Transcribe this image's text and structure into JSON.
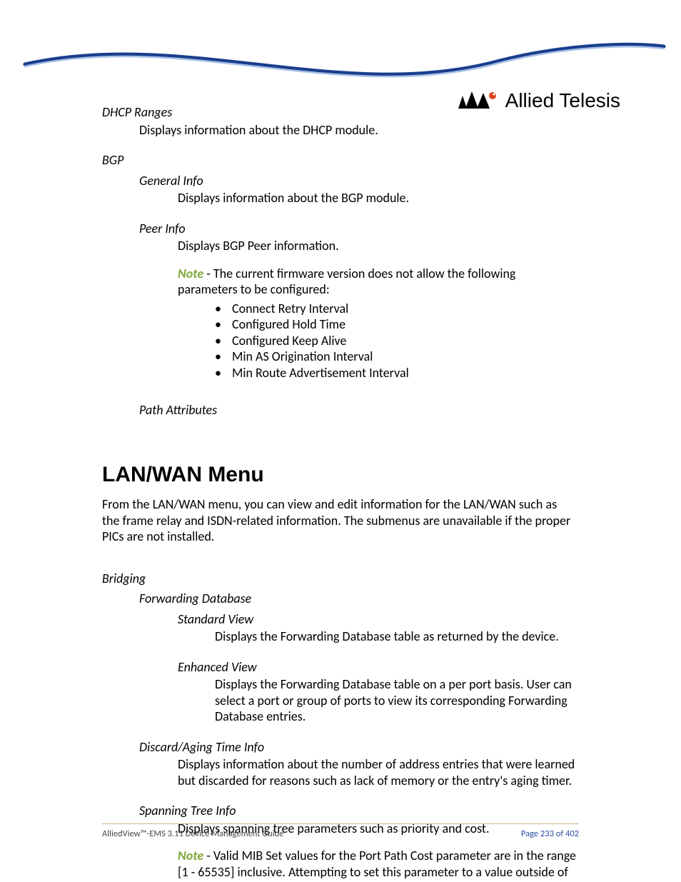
{
  "brand": "Allied Telesis",
  "sections": {
    "dhcp_ranges": {
      "term": "DHCP Ranges",
      "desc": "Displays information about the DHCP module."
    },
    "bgp": {
      "term": "BGP",
      "general": {
        "term": "General Info",
        "desc": "Displays information about the BGP module."
      },
      "peer": {
        "term": "Peer Info",
        "desc": "Displays BGP Peer information.",
        "note_label": "Note",
        "note_text": " - The current firmware version does not allow the following parameters to be configured:",
        "bullets": [
          "Connect Retry Interval",
          "Configured Hold Time",
          "Configured Keep Alive",
          "Min AS Origination Interval",
          "Min Route Advertisement Interval"
        ]
      },
      "path_attributes": {
        "term": "Path Attributes"
      }
    },
    "lanwan": {
      "heading": "LAN/WAN Menu",
      "intro": "From the LAN/WAN menu, you can view and edit information for the LAN/WAN such as the frame relay and ISDN-related information. The submenus are unavailable if the proper PICs are not installed.",
      "bridging": {
        "term": "Bridging",
        "fdb": {
          "term": "Forwarding Database",
          "standard": {
            "term": "Standard View",
            "desc": "Displays the Forwarding Database table as returned by the device."
          },
          "enhanced": {
            "term": "Enhanced View",
            "desc": "Displays the Forwarding Database table on a per port basis. User can select a port or group of ports to view its corresponding Forwarding Database entries."
          }
        },
        "discard": {
          "term": "Discard/Aging Time Info",
          "desc": "Displays information about the number of address entries that were learned but discarded for reasons such as lack of memory or the entry's aging timer."
        },
        "stp": {
          "term": "Spanning Tree Info",
          "desc": "Displays spanning tree parameters such as priority and cost.",
          "note_label": "Note",
          "note_text": " - Valid MIB Set values for the Port Path Cost parameter are in the range [1 - 65535] inclusive. Attempting to set this parameter to a value outside of"
        }
      }
    }
  },
  "footer": {
    "left": "AlliedView™-EMS 3.11 Device Management Guide",
    "right": "Page 233 of 402"
  }
}
